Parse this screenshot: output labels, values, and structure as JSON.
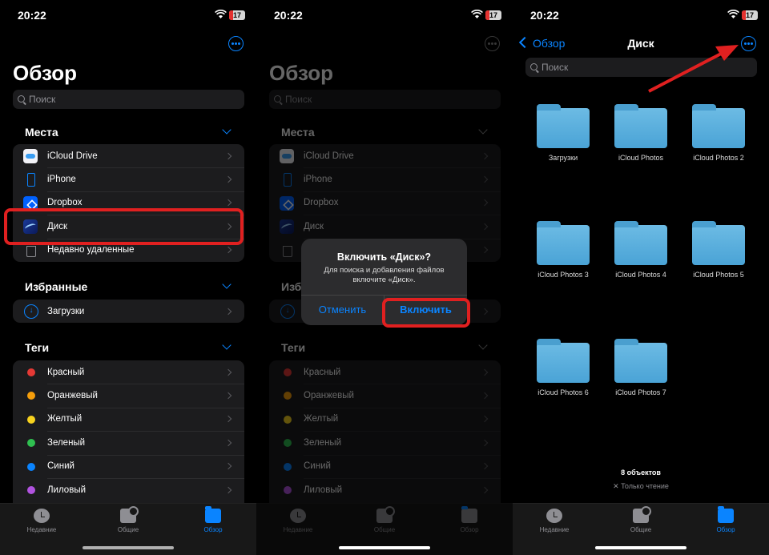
{
  "status": {
    "time": "20:22",
    "battery": "17"
  },
  "overview": {
    "title": "Обзор",
    "search_placeholder": "Поиск",
    "places_header": "Места",
    "places": [
      {
        "label": "iCloud Drive",
        "icon": "icloud-icon"
      },
      {
        "label": "iPhone",
        "icon": "iphone-icon"
      },
      {
        "label": "Dropbox",
        "icon": "dropbox-icon"
      },
      {
        "label": "Диск",
        "icon": "disk-icon"
      },
      {
        "label": "Недавно удаленные",
        "icon": "trash-icon"
      }
    ],
    "favorites_header": "Избранные",
    "favorites": [
      {
        "label": "Загрузки",
        "icon": "download-icon"
      }
    ],
    "tags_header": "Теги",
    "tags": [
      {
        "label": "Красный",
        "color": "#e53935"
      },
      {
        "label": "Оранжевый",
        "color": "#f59e0b"
      },
      {
        "label": "Желтый",
        "color": "#f7d21e"
      },
      {
        "label": "Зеленый",
        "color": "#2fbf50"
      },
      {
        "label": "Синий",
        "color": "#0a84ff"
      },
      {
        "label": "Лиловый",
        "color": "#b153e0"
      }
    ]
  },
  "tabbar": {
    "recent": "Недавние",
    "shared": "Общие",
    "browse": "Обзор"
  },
  "alert": {
    "title": "Включить «Диск»?",
    "message": "Для поиска и добавления файлов включите «Диск».",
    "cancel": "Отменить",
    "enable": "Включить"
  },
  "disk": {
    "back": "Обзор",
    "title": "Диск",
    "search_placeholder": "Поиск",
    "folders": [
      "Загрузки",
      "iCloud Photos",
      "iCloud Photos 2",
      "iCloud Photos 3",
      "iCloud Photos 4",
      "iCloud Photos 5",
      "iCloud Photos 6",
      "iCloud Photos 7"
    ],
    "count": "8 объектов",
    "readonly": "Только чтение"
  },
  "colors": {
    "accent": "#0a84ff",
    "highlight": "#e02020"
  }
}
